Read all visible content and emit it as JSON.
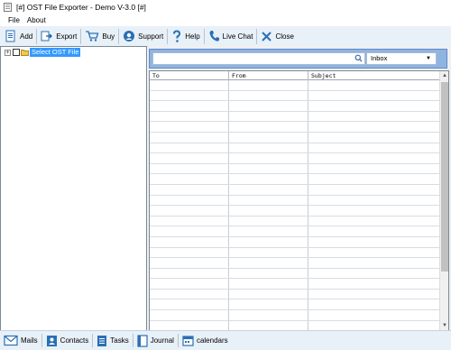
{
  "window": {
    "title": "[#] OST File Exporter - Demo V-3.0 [#]"
  },
  "menu": {
    "items": [
      "File",
      "About"
    ]
  },
  "toolbar": {
    "add_label": "Add",
    "export_label": "Export",
    "buy_label": "Buy",
    "support_label": "Support",
    "help_label": "Help",
    "livechat_label": "Live Chat",
    "close_label": "Close"
  },
  "tree": {
    "root_label": "Select OST File",
    "expander": "+"
  },
  "search": {
    "value": "",
    "placeholder": ""
  },
  "folder_select": {
    "selected": "Inbox"
  },
  "grid": {
    "columns": [
      "To",
      "From",
      "Subject"
    ],
    "row_count": 24
  },
  "bottom_tabs": {
    "mails": "Mails",
    "contacts": "Contacts",
    "tasks": "Tasks",
    "journal": "Journal",
    "calendars": "calendars"
  },
  "colors": {
    "accent": "#3399ff",
    "toolbar_bg": "#e8f0f8",
    "search_strip": "#8fb4e2"
  }
}
